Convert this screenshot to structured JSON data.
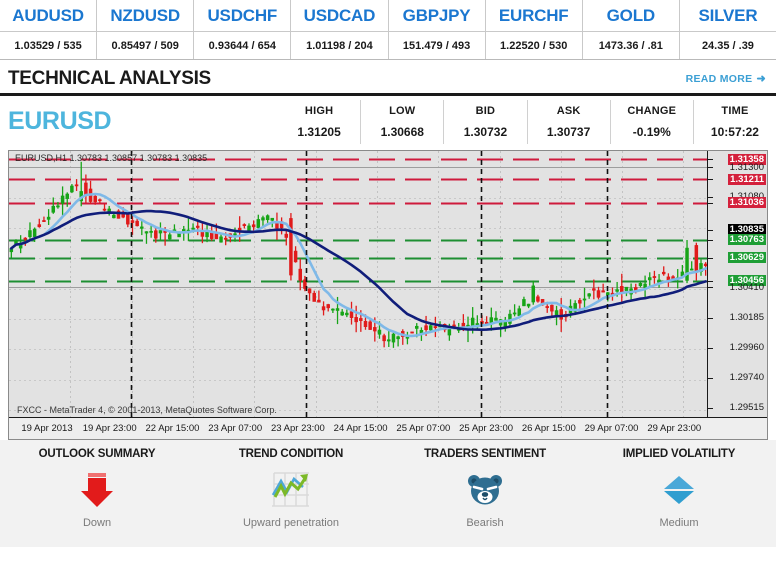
{
  "ticker": {
    "items": [
      {
        "symbol": "AUDUSD",
        "price": "1.03529 / 535"
      },
      {
        "symbol": "NZDUSD",
        "price": "0.85497 / 509"
      },
      {
        "symbol": "USDCHF",
        "price": "0.93644 / 654"
      },
      {
        "symbol": "USDCAD",
        "price": "1.01198 / 204"
      },
      {
        "symbol": "GBPJPY",
        "price": "151.479 / 493"
      },
      {
        "symbol": "EURCHF",
        "price": "1.22520 / 530"
      },
      {
        "symbol": "GOLD",
        "price": "1473.36 / .81"
      },
      {
        "symbol": "SILVER",
        "price": "24.35 / .39"
      }
    ],
    "symbol_color": "#1b77d0"
  },
  "header": {
    "title": "TECHNICAL ANALYSIS",
    "read_more": "READ MORE",
    "read_more_arrow": "➜",
    "link_color": "#3b9fd4"
  },
  "quote": {
    "pair": "EURUSD",
    "pair_color": "#4db5dd",
    "fields": [
      {
        "label": "HIGH",
        "value": "1.31205"
      },
      {
        "label": "LOW",
        "value": "1.30668"
      },
      {
        "label": "BID",
        "value": "1.30732"
      },
      {
        "label": "ASK",
        "value": "1.30737"
      },
      {
        "label": "CHANGE",
        "value": "-0.19%"
      },
      {
        "label": "TIME",
        "value": "10:57:22"
      }
    ]
  },
  "chart_data": {
    "type": "line",
    "title": "EURUSD,H1  1.30783 1.30857 1.30783 1.30835",
    "credit": "FXCC - MetaTrader 4, © 2001-2013, MetaQuotes Software Corp.",
    "symbol": "EURUSD",
    "timeframe": "H1",
    "ohlc": {
      "open": "1.30783",
      "high": "1.30857",
      "low": "1.30783",
      "close": "1.30835"
    },
    "ylim": [
      1.2944,
      1.3142
    ],
    "grid": true,
    "legend": "none",
    "price_labels": [
      {
        "value": "1.31358",
        "price": 1.31358,
        "style": "red"
      },
      {
        "value": "1.31300",
        "price": 1.313,
        "style": "plain"
      },
      {
        "value": "1.31211",
        "price": 1.31211,
        "style": "red"
      },
      {
        "value": "1.31080",
        "price": 1.3108,
        "style": "plain"
      },
      {
        "value": "1.31036",
        "price": 1.31036,
        "style": "red"
      },
      {
        "value": "1.30835",
        "price": 1.30835,
        "style": "black"
      },
      {
        "value": "1.30763",
        "price": 1.30763,
        "style": "green"
      },
      {
        "value": "1.30629",
        "price": 1.30629,
        "style": "green"
      },
      {
        "value": "1.30456",
        "price": 1.30456,
        "style": "green"
      },
      {
        "value": "1.30410",
        "price": 1.3041,
        "style": "plain"
      },
      {
        "value": "1.30185",
        "price": 1.30185,
        "style": "plain"
      },
      {
        "value": "1.29960",
        "price": 1.2996,
        "style": "plain"
      },
      {
        "value": "1.29740",
        "price": 1.2974,
        "style": "plain"
      },
      {
        "value": "1.29515",
        "price": 1.29515,
        "style": "plain"
      }
    ],
    "hlines_red": [
      1.31358,
      1.31211,
      1.31036
    ],
    "hlines_green": [
      1.30763,
      1.30629,
      1.30456
    ],
    "time_labels": [
      "19 Apr 2013",
      "19 Apr 23:00",
      "22 Apr 15:00",
      "23 Apr 07:00",
      "23 Apr 23:00",
      "24 Apr 15:00",
      "25 Apr 07:00",
      "25 Apr 23:00",
      "26 Apr 15:00",
      "29 Apr 07:00",
      "29 Apr 23:00"
    ],
    "candle_up_color": "#17a417",
    "candle_down_color": "#e01b1b",
    "ma_fast_color": "#7fb9e8",
    "ma_slow_color": "#101d7a"
  },
  "indicators": [
    {
      "title": "OUTLOOK SUMMARY",
      "value": "Down",
      "icon": "down-arrow-icon"
    },
    {
      "title": "TREND CONDITION",
      "value": "Upward penetration",
      "icon": "trend-chart-icon"
    },
    {
      "title": "TRADERS SENTIMENT",
      "value": "Bearish",
      "icon": "bear-icon"
    },
    {
      "title": "IMPLIED VOLATILITY",
      "value": "Medium",
      "icon": "diamond-icon"
    }
  ]
}
